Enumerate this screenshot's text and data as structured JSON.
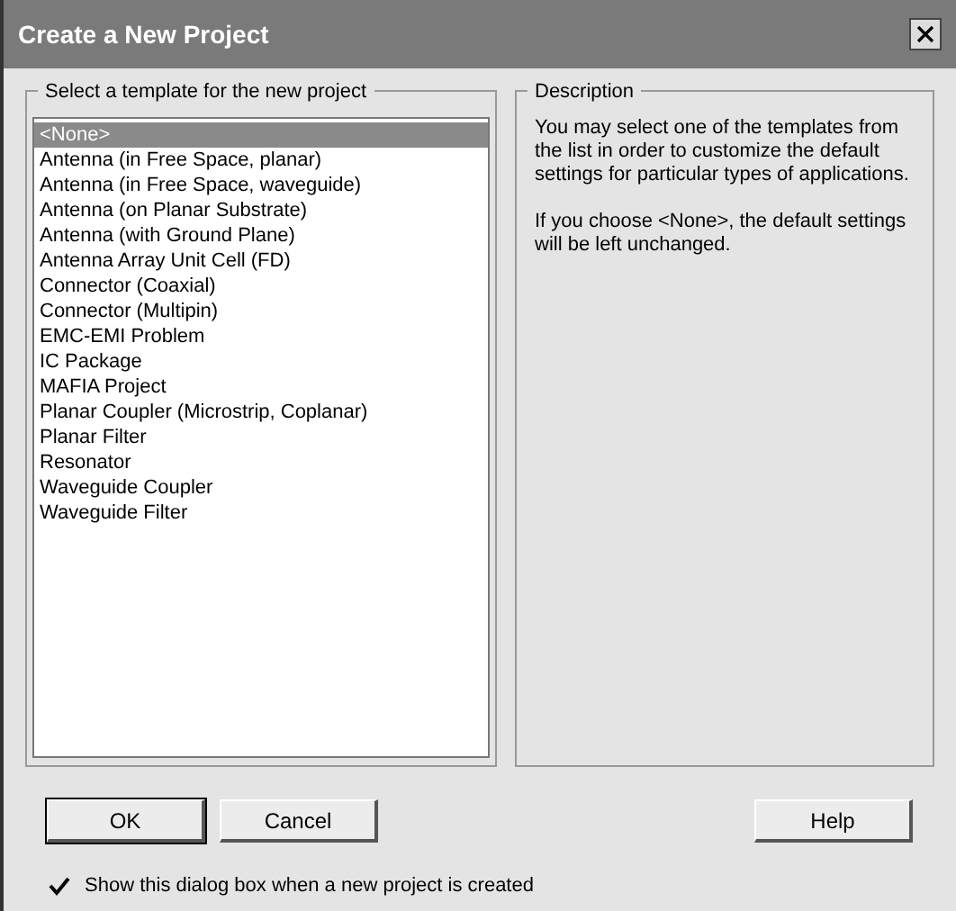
{
  "window": {
    "title": "Create a New Project"
  },
  "templates": {
    "label": "Select a template for the new project",
    "items": [
      {
        "text": "<None>",
        "selected": true
      },
      {
        "text": "Antenna (in Free Space, planar)",
        "selected": false
      },
      {
        "text": "Antenna (in Free Space, waveguide)",
        "selected": false
      },
      {
        "text": "Antenna (on Planar Substrate)",
        "selected": false
      },
      {
        "text": "Antenna (with Ground Plane)",
        "selected": false
      },
      {
        "text": "Antenna Array Unit Cell (FD)",
        "selected": false
      },
      {
        "text": "Connector (Coaxial)",
        "selected": false
      },
      {
        "text": "Connector (Multipin)",
        "selected": false
      },
      {
        "text": "EMC-EMI Problem",
        "selected": false
      },
      {
        "text": "IC Package",
        "selected": false
      },
      {
        "text": "MAFIA Project",
        "selected": false
      },
      {
        "text": "Planar Coupler (Microstrip, Coplanar)",
        "selected": false
      },
      {
        "text": "Planar Filter",
        "selected": false
      },
      {
        "text": "Resonator",
        "selected": false
      },
      {
        "text": "Waveguide Coupler",
        "selected": false
      },
      {
        "text": "Waveguide Filter",
        "selected": false
      }
    ]
  },
  "description": {
    "label": "Description",
    "paragraphs": [
      "You may select one of the templates from the list in order to customize the default settings for particular types of applications.",
      "If you choose <None>, the default settings will be left unchanged."
    ]
  },
  "buttons": [
    {
      "label": "OK",
      "default": true
    },
    {
      "label": "Cancel",
      "default": false
    },
    {
      "label": "Help",
      "default": false
    }
  ],
  "show_dialog": {
    "label": "Show this dialog box when a new project is created",
    "checked": true
  }
}
